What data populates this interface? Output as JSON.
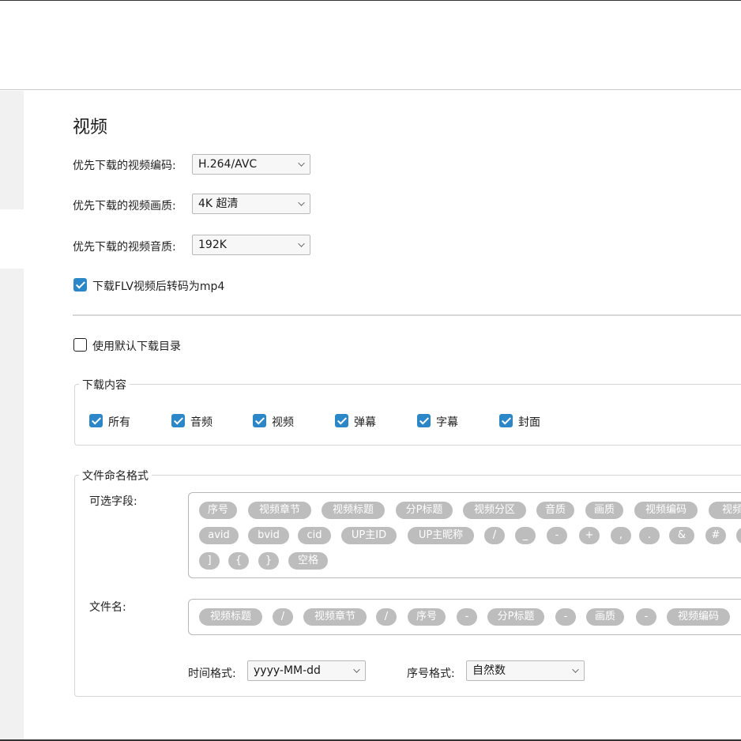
{
  "section": {
    "title": "视频"
  },
  "video_settings": {
    "codec_label": "优先下载的视频编码:",
    "codec_value": "H.264/AVC",
    "quality_label": "优先下载的视频画质:",
    "quality_value": "4K 超清",
    "audio_label": "优先下载的视频音质:",
    "audio_value": "192K",
    "transcode_label": "下载FLV视频后转码为mp4",
    "transcode_checked": true
  },
  "default_dir": {
    "label": "使用默认下载目录",
    "checked": false
  },
  "download_content": {
    "title": "下载内容",
    "items": [
      {
        "label": "所有",
        "checked": true
      },
      {
        "label": "音频",
        "checked": true
      },
      {
        "label": "视频",
        "checked": true
      },
      {
        "label": "弹幕",
        "checked": true
      },
      {
        "label": "字幕",
        "checked": true
      },
      {
        "label": "封面",
        "checked": true
      }
    ]
  },
  "naming": {
    "title": "文件命名格式",
    "optional_fields_label": "可选字段:",
    "optional_fields": [
      "序号",
      "视频章节",
      "视频标题",
      "分P标题",
      "视频分区",
      "音质",
      "画质",
      "视频编码",
      "视频",
      "avid",
      "bvid",
      "cid",
      "UP主ID",
      "UP主昵称",
      "/",
      "_",
      "-",
      "+",
      ",",
      ".",
      "&",
      "#",
      "(",
      "]",
      "{",
      "}",
      "空格"
    ],
    "filename_label": "文件名:",
    "filename_fields": [
      "视频标题",
      "/",
      "视频章节",
      "/",
      "序号",
      "-",
      "分P标题",
      "-",
      "画质",
      "-",
      "视频编码"
    ],
    "time_format_label": "时间格式:",
    "time_format_value": "yyyy-MM-dd",
    "number_format_label": "序号格式:",
    "number_format_value": "自然数"
  },
  "colors": {
    "accent": "#2b87c8",
    "chip_bg": "#bdbdbd",
    "sidebar_bg": "#f1f1f1"
  }
}
